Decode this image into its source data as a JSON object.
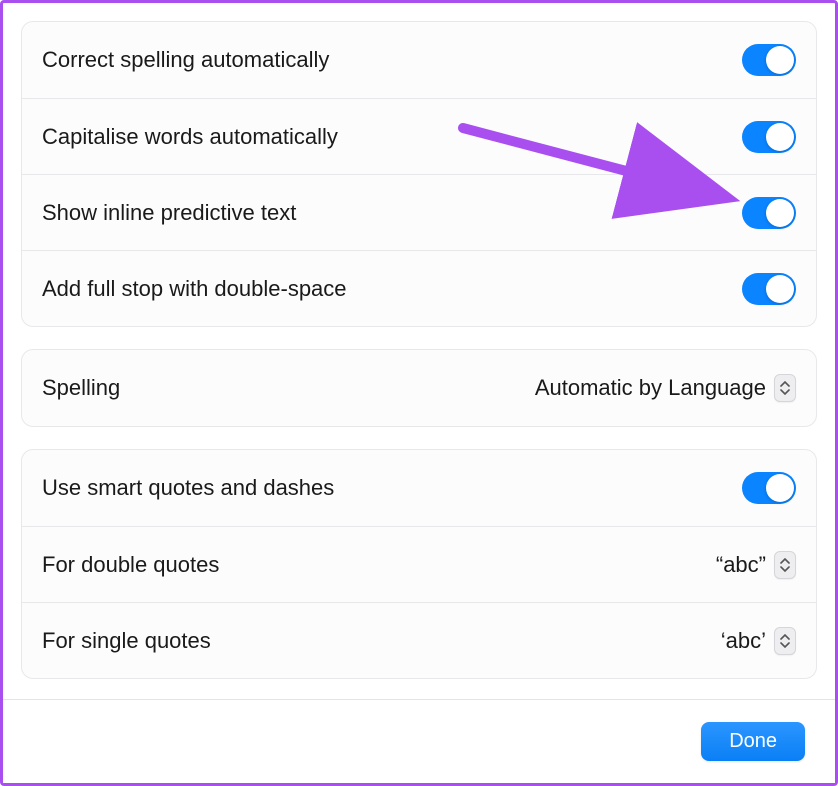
{
  "group1": {
    "items": [
      {
        "label": "Correct spelling automatically",
        "toggle": true
      },
      {
        "label": "Capitalise words automatically",
        "toggle": true
      },
      {
        "label": "Show inline predictive text",
        "toggle": true
      },
      {
        "label": "Add full stop with double-space",
        "toggle": true
      }
    ]
  },
  "group2": {
    "items": [
      {
        "label": "Spelling",
        "value": "Automatic by Language"
      }
    ]
  },
  "group3": {
    "items": [
      {
        "label": "Use smart quotes and dashes",
        "toggle": true
      },
      {
        "label": "For double quotes",
        "value": "“abc”"
      },
      {
        "label": "For single quotes",
        "value": "‘abc’"
      }
    ]
  },
  "footer": {
    "done_label": "Done"
  },
  "colors": {
    "accent": "#0a84ff",
    "annotation": "#a94ff0"
  }
}
